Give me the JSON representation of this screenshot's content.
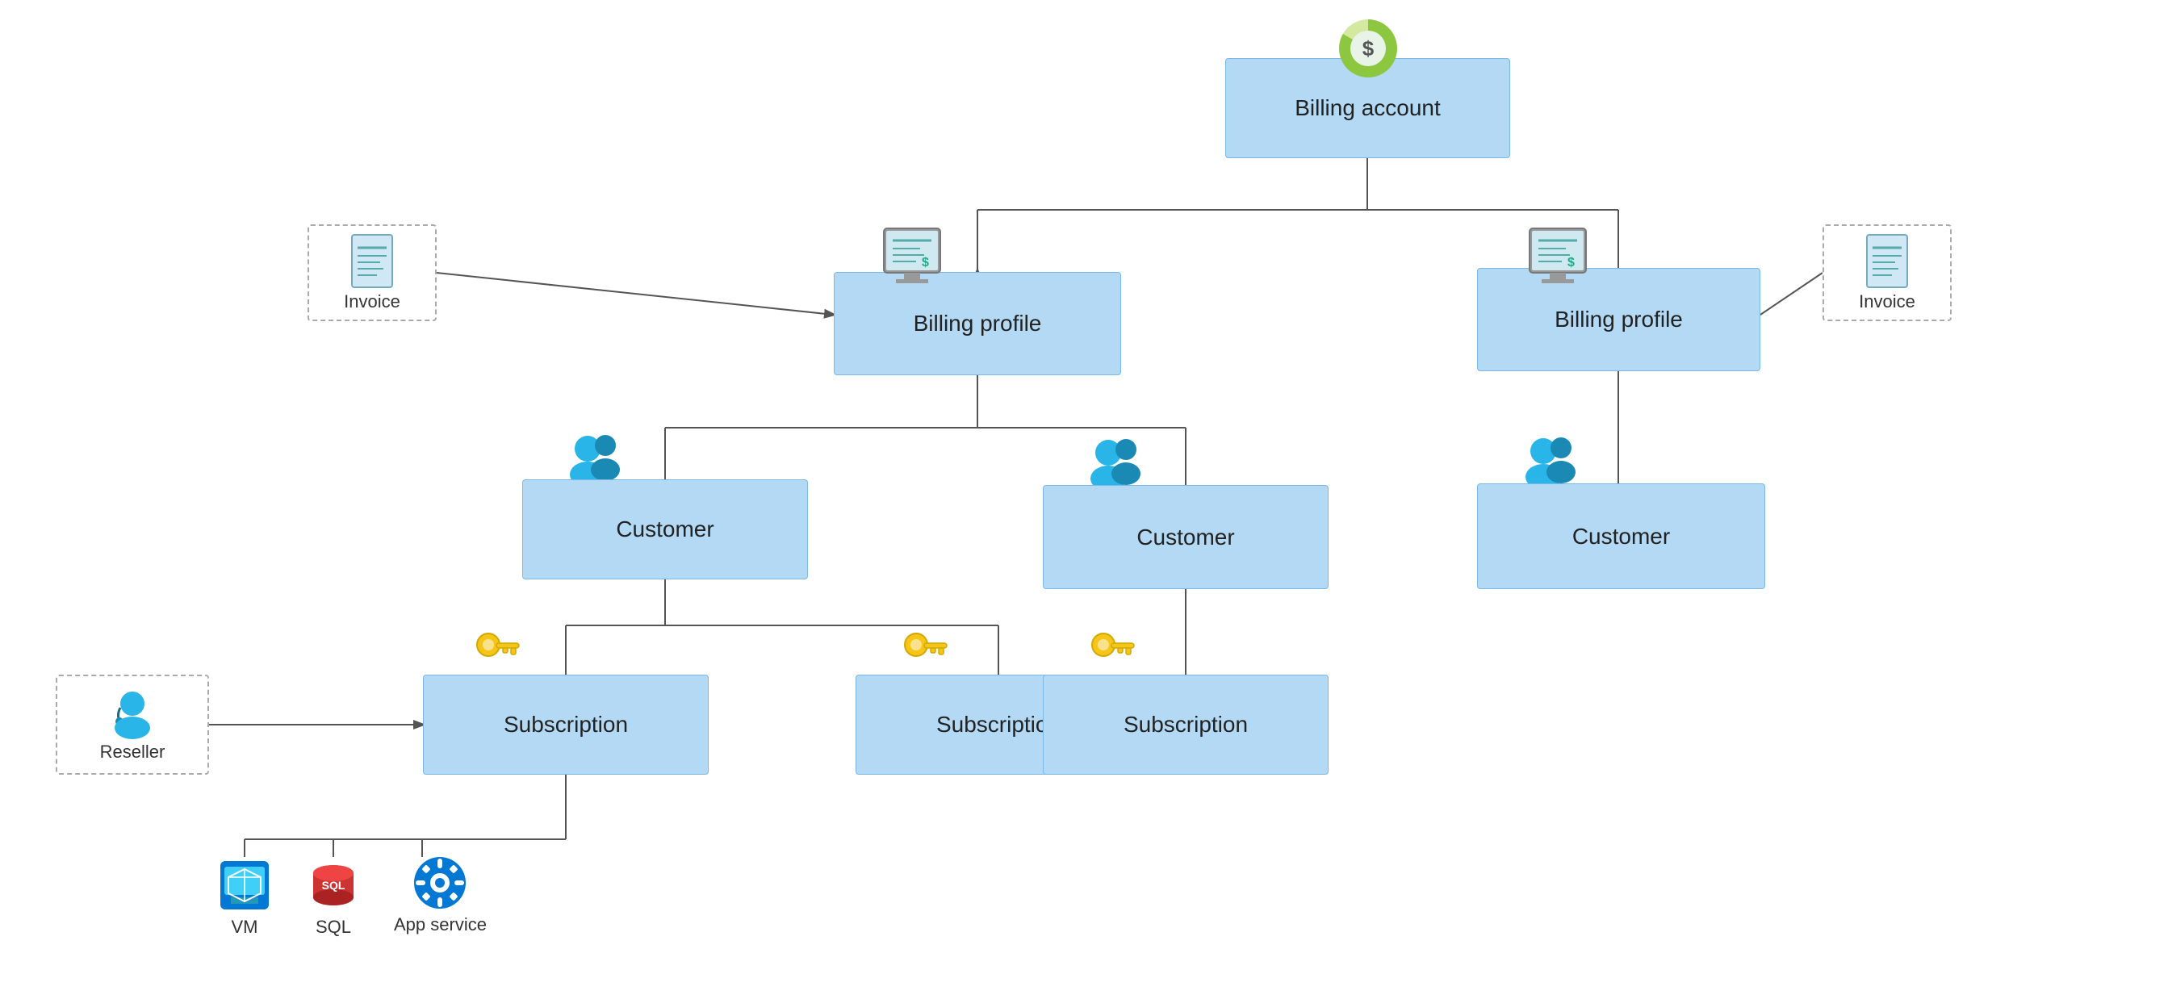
{
  "nodes": {
    "billing_account": {
      "label": "Billing account"
    },
    "billing_profile_left": {
      "label": "Billing profile"
    },
    "billing_profile_right": {
      "label": "Billing profile"
    },
    "customer_left": {
      "label": "Customer"
    },
    "customer_mid": {
      "label": "Customer"
    },
    "customer_right": {
      "label": "Customer"
    },
    "subscription_left": {
      "label": "Subscription"
    },
    "subscription_mid": {
      "label": "Subscription"
    },
    "subscription_right": {
      "label": "Subscription"
    },
    "reseller": {
      "label": "Reseller"
    },
    "invoice_left": {
      "label": "Invoice"
    },
    "invoice_right": {
      "label": "Invoice"
    },
    "vm": {
      "label": "VM"
    },
    "sql": {
      "label": "SQL"
    },
    "app_service": {
      "label": "App service"
    }
  }
}
